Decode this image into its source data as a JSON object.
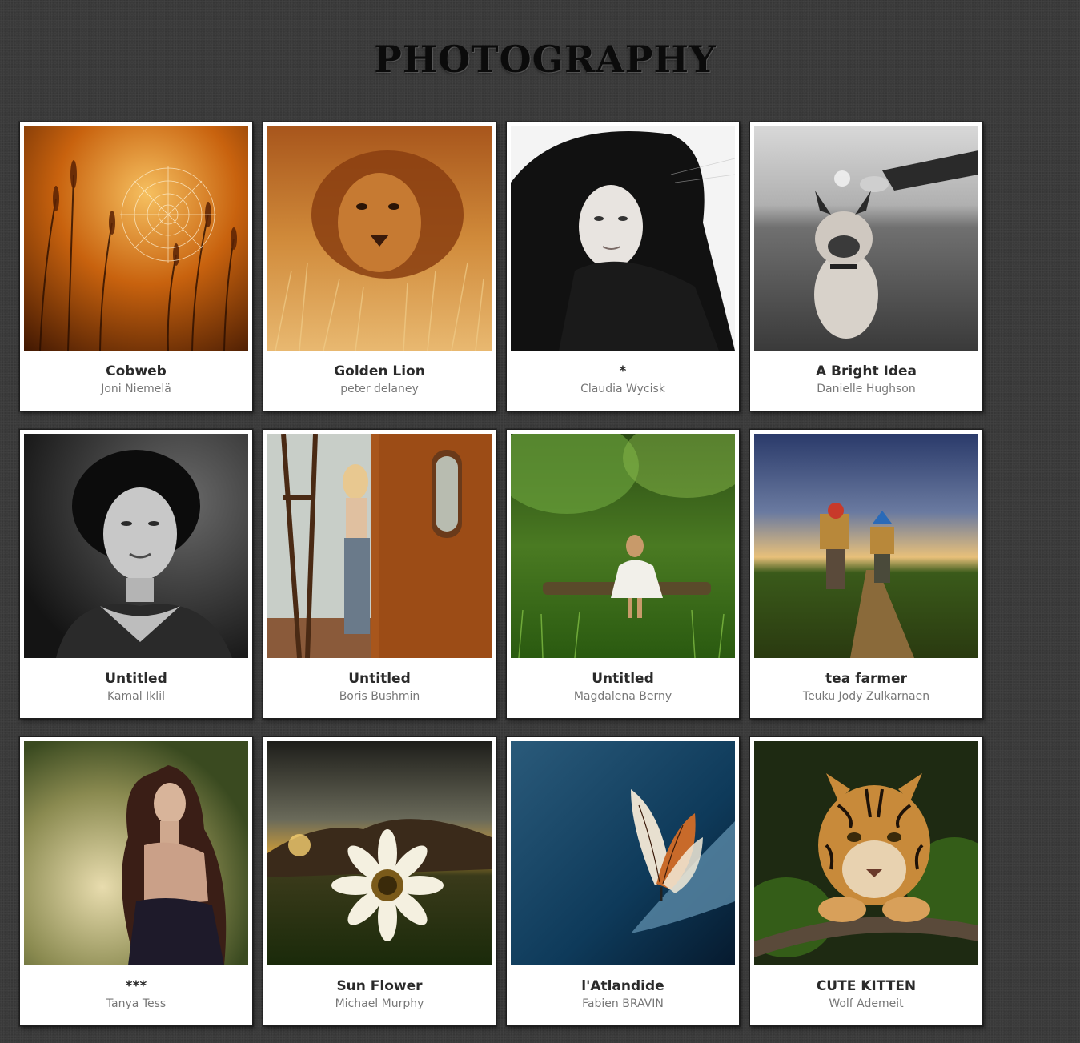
{
  "page": {
    "title": "PHOTOGRAPHY",
    "background": "#3a3a3a"
  },
  "photos": [
    {
      "title": "Cobweb",
      "author": "Joni Niemelä",
      "subject": "spider web among golden grass at sunset",
      "icon": "cobweb-photo",
      "palette": [
        "#4a1c02",
        "#c2600e",
        "#f0b04a"
      ]
    },
    {
      "title": "Golden Lion",
      "author": "peter delaney",
      "subject": "lion in tall golden grass",
      "icon": "lion-photo",
      "palette": [
        "#7a3a0c",
        "#d08a3a",
        "#f0c27a"
      ]
    },
    {
      "title": "*",
      "author": "Claudia Wycisk",
      "subject": "black and white portrait of woman in black hood",
      "icon": "portrait-photo",
      "palette": [
        "#0a0a0a",
        "#f2f2f2",
        "#9a9a9a"
      ]
    },
    {
      "title": "A Bright Idea",
      "author": "Danielle Hughson",
      "subject": "french bulldog on beach with hand holding lightbulb",
      "icon": "bulldog-photo",
      "palette": [
        "#5a5a5a",
        "#c8c8c8",
        "#2a2a2a"
      ]
    },
    {
      "title": "Untitled",
      "author": "Kamal Iklil",
      "subject": "black and white portrait of woman",
      "icon": "portrait-photo",
      "palette": [
        "#111111",
        "#6a6a6a",
        "#d0d0d0"
      ]
    },
    {
      "title": "Untitled",
      "author": "Boris Bushmin",
      "subject": "woman leaning on rusty vehicle",
      "icon": "rusty-train-photo",
      "palette": [
        "#8a3a10",
        "#c8cfc8",
        "#b86a2a"
      ]
    },
    {
      "title": "Untitled",
      "author": "Magdalena Berny",
      "subject": "girl sitting on log in green meadow",
      "icon": "meadow-photo",
      "palette": [
        "#1c3a0c",
        "#5a9a2a",
        "#e8e8e0"
      ]
    },
    {
      "title": "tea farmer",
      "author": "Teuku Jody Zulkarnaen",
      "subject": "tea farmers carrying baskets on dirt road",
      "icon": "farmer-photo",
      "palette": [
        "#2a3a6a",
        "#d8b068",
        "#3a5a1a"
      ]
    },
    {
      "title": "***",
      "author": "Tanya Tess",
      "subject": "woman with long curly hair in forest",
      "icon": "portrait-photo",
      "palette": [
        "#6a6a30",
        "#3a1e16",
        "#c8c09a"
      ]
    },
    {
      "title": "Sun Flower",
      "author": "Michael Murphy",
      "subject": "daisy flower in field under dramatic sky",
      "icon": "flower-photo",
      "palette": [
        "#3a3a2a",
        "#e8a83a",
        "#f4f0e0"
      ]
    },
    {
      "title": "l'Atlandide",
      "author": "Fabien BRAVIN",
      "subject": "butterfly on blue leaf",
      "icon": "butterfly-photo",
      "palette": [
        "#0a2a4a",
        "#2a6a8a",
        "#c86a2a"
      ]
    },
    {
      "title": "CUTE KITTEN",
      "author": "Wolf Ademeit",
      "subject": "tiger cub lying on branch",
      "icon": "tiger-photo",
      "palette": [
        "#1c2a10",
        "#c88a3a",
        "#3a5a1a"
      ]
    }
  ]
}
